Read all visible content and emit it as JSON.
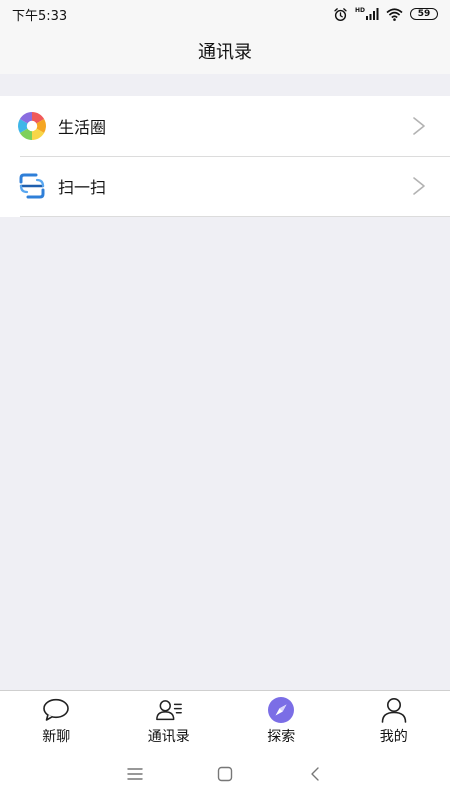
{
  "status_bar": {
    "time": "下午5:33",
    "network_label": "HD",
    "battery_level": "59"
  },
  "header": {
    "title": "通讯录"
  },
  "list": {
    "items": [
      {
        "label": "生活圈",
        "icon": "camera-aperture-icon"
      },
      {
        "label": "扫一扫",
        "icon": "scan-icon"
      }
    ]
  },
  "tab_bar": {
    "tabs": [
      {
        "label": "新聊",
        "icon": "chat-bubble-icon",
        "active": false
      },
      {
        "label": "通讯录",
        "icon": "contacts-icon",
        "active": false
      },
      {
        "label": "探索",
        "icon": "compass-icon",
        "active": true
      },
      {
        "label": "我的",
        "icon": "person-icon",
        "active": false
      }
    ]
  },
  "colors": {
    "accent": "#7b6ee6",
    "background": "#efeff4",
    "divider": "#dcdcdc",
    "chevron": "#b3b3b3",
    "scan_blue": "#2f7fd8"
  }
}
